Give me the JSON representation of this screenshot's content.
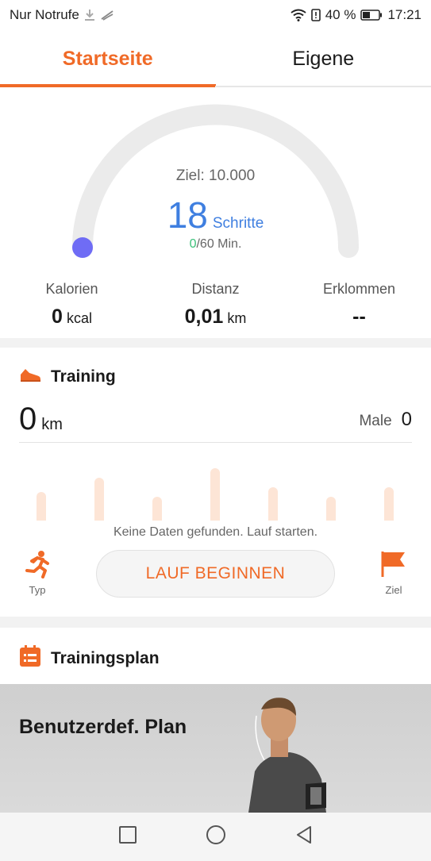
{
  "status_bar": {
    "carrier": "Nur Notrufe",
    "battery": "40 %",
    "time": "17:21"
  },
  "tabs": [
    {
      "label": "Startseite",
      "active": true
    },
    {
      "label": "Eigene",
      "active": false
    }
  ],
  "steps": {
    "goal": "Ziel: 10.000",
    "count": "18",
    "unit": "Schritte",
    "minutes_done": "0",
    "minutes_rest": "/60 Min.",
    "progress": 0.0018
  },
  "stats": [
    {
      "label": "Kalorien",
      "value": "0",
      "unit": "kcal"
    },
    {
      "label": "Distanz",
      "value": "0,01",
      "unit": "km"
    },
    {
      "label": "Erklommen",
      "value": "--",
      "unit": ""
    }
  ],
  "training": {
    "title": "Training",
    "distance": "0",
    "distance_unit": "km",
    "count_label": "Male",
    "count": "0",
    "no_data": "Keine Daten gefunden. Lauf starten.",
    "start_label": "LAUF BEGINNEN",
    "type_label": "Typ",
    "goal_label": "Ziel",
    "accent": "#f06a27"
  },
  "plan": {
    "title": "Trainingsplan",
    "card_title": "Benutzerdef. Plan"
  },
  "nav": {
    "icons": [
      "recents-icon",
      "home-icon",
      "back-icon"
    ]
  }
}
